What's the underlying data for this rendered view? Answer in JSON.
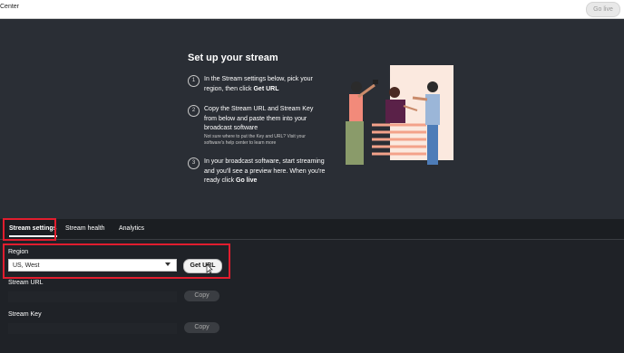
{
  "topbar": {
    "title": "Center",
    "golive_label": "Go live"
  },
  "hero": {
    "heading": "Set up your stream",
    "steps": [
      {
        "num": "1",
        "text_a": "In the Stream settings below, pick your region, then click ",
        "text_b": "Get URL"
      },
      {
        "num": "2",
        "text_a": "Copy the Stream URL and Stream Key from below and paste them into your broadcast software",
        "note": "Not sure where to put the Key and URL? Visit your software's help center to learn more"
      },
      {
        "num": "3",
        "text_a": "In your broadcast software, start streaming and you'll see a preview here. When you're ready click ",
        "text_b": "Go live"
      }
    ]
  },
  "tabs": [
    {
      "label": "Stream settings"
    },
    {
      "label": "Stream health"
    },
    {
      "label": "Analytics"
    }
  ],
  "settings": {
    "region_label": "Region",
    "region_value": "US, West",
    "get_url_label": "Get URL",
    "stream_url_label": "Stream URL",
    "stream_key_label": "Stream Key",
    "copy_label": "Copy"
  },
  "colors": {
    "highlight": "#e11d2e",
    "background": "#2a2e35"
  }
}
